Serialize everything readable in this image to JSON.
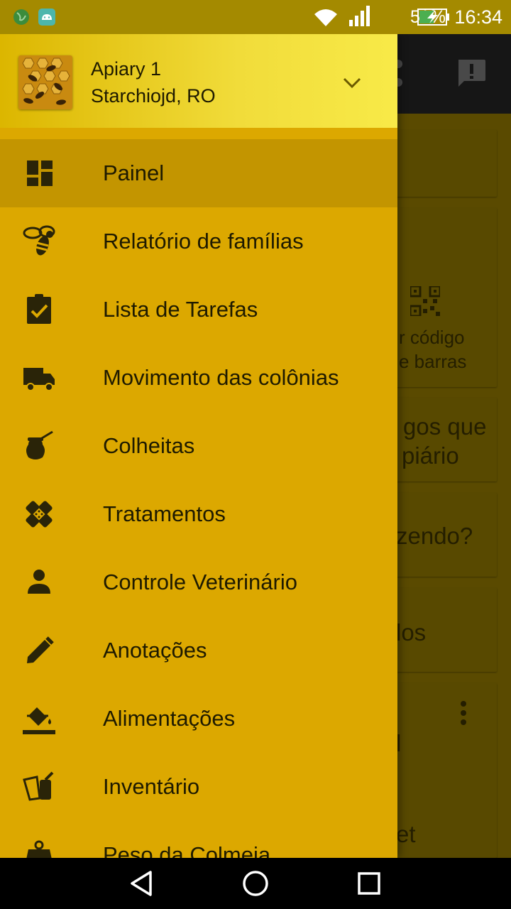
{
  "status_bar": {
    "battery": "51%",
    "time": "16:34",
    "icons": [
      "app-globe-icon",
      "android-icon",
      "wifi-icon",
      "signal-icon",
      "battery-charging-icon"
    ]
  },
  "drawer": {
    "header": {
      "title": "Apiary 1",
      "subtitle": "Starchiojd, RO",
      "chevron": "chevron-down-icon"
    },
    "items": [
      {
        "label": "Painel",
        "icon": "dashboard-icon",
        "selected": true
      },
      {
        "label": "Relatório de famílias",
        "icon": "bee-icon"
      },
      {
        "label": "Lista de Tarefas",
        "icon": "clipboard-check-icon"
      },
      {
        "label": "Movimento das colônias",
        "icon": "truck-icon"
      },
      {
        "label": "Colheitas",
        "icon": "honey-pot-icon"
      },
      {
        "label": "Tratamentos",
        "icon": "bandage-icon"
      },
      {
        "label": "Controle Veterinário",
        "icon": "person-icon"
      },
      {
        "label": "Anotações",
        "icon": "pencil-icon"
      },
      {
        "label": "Alimentações",
        "icon": "paint-bucket-icon"
      },
      {
        "label": "Inventário",
        "icon": "smoker-icon"
      },
      {
        "label": "Peso da Colmeia",
        "icon": "weight-icon"
      }
    ]
  },
  "background": {
    "scan_text_1": "r código",
    "scan_text_2": "e barras",
    "text_1": "gos que",
    "text_2": "piário",
    "text_3": "zendo?",
    "text_4": "los",
    "text_5": "l",
    "text_6": "et",
    "icons": [
      "share-icon",
      "feedback-icon",
      "qr-code-icon",
      "more-vert-icon"
    ]
  },
  "colors": {
    "drawer": "#dca800",
    "selected": "#c39500",
    "header_gradient_end": "#f8ea48",
    "text": "#1e1a00"
  }
}
